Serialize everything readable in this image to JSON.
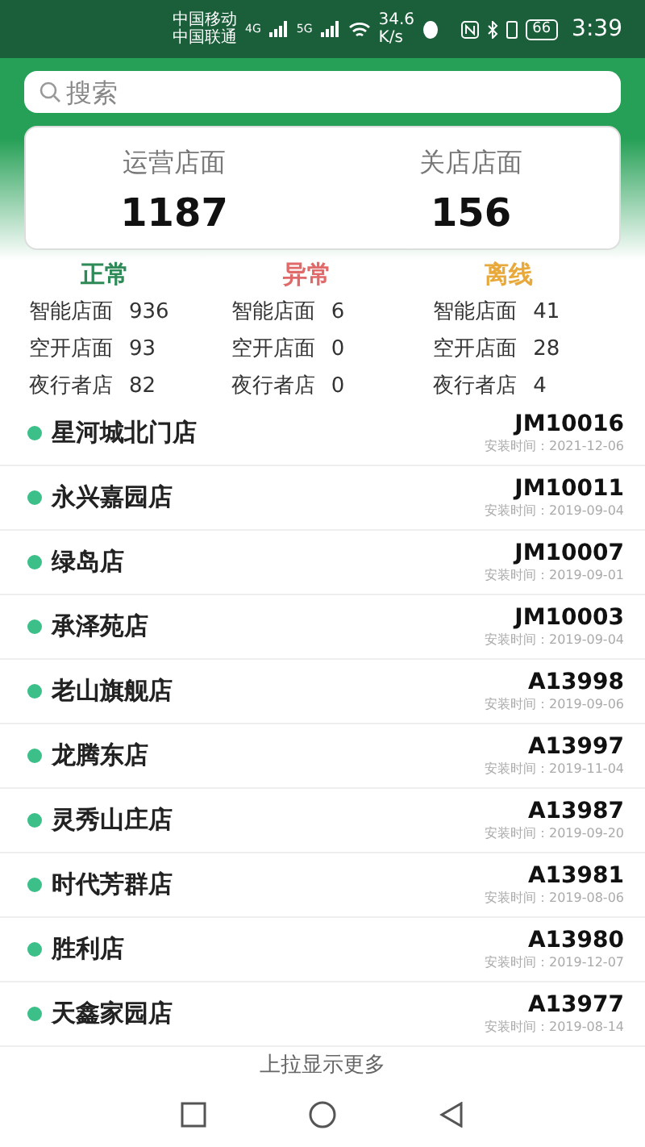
{
  "status_bar": {
    "carriers": [
      "中国移动",
      "中国联通"
    ],
    "network_labels": [
      "4G",
      "5G"
    ],
    "speed": "34.6",
    "speed_unit": "K/s",
    "battery": "66",
    "time": "3:39"
  },
  "search": {
    "placeholder": "搜索"
  },
  "summary": [
    {
      "label": "运营店面",
      "value": "1187"
    },
    {
      "label": "关店店面",
      "value": "156"
    }
  ],
  "categories": [
    {
      "title": "正常",
      "color": "#2e8b57",
      "rows": [
        {
          "label": "智能店面",
          "value": "936"
        },
        {
          "label": "空开店面",
          "value": "93"
        },
        {
          "label": "夜行者店",
          "value": "82"
        }
      ]
    },
    {
      "title": "异常",
      "color": "#e06a6a",
      "rows": [
        {
          "label": "智能店面",
          "value": "6"
        },
        {
          "label": "空开店面",
          "value": "0"
        },
        {
          "label": "夜行者店",
          "value": "0"
        }
      ]
    },
    {
      "title": "离线",
      "color": "#e8a93a",
      "rows": [
        {
          "label": "智能店面",
          "value": "41"
        },
        {
          "label": "空开店面",
          "value": "28"
        },
        {
          "label": "夜行者店",
          "value": "4"
        }
      ]
    }
  ],
  "stores": [
    {
      "name": "星河城北门店",
      "code": "JM10016",
      "install": "安装时间：2021-12-06"
    },
    {
      "name": "永兴嘉园店",
      "code": "JM10011",
      "install": "安装时间：2019-09-04"
    },
    {
      "name": "绿岛店",
      "code": "JM10007",
      "install": "安装时间：2019-09-01"
    },
    {
      "name": "承泽苑店",
      "code": "JM10003",
      "install": "安装时间：2019-09-04"
    },
    {
      "name": "老山旗舰店",
      "code": "A13998",
      "install": "安装时间：2019-09-06"
    },
    {
      "name": "龙腾东店",
      "code": "A13997",
      "install": "安装时间：2019-11-04"
    },
    {
      "name": "灵秀山庄店",
      "code": "A13987",
      "install": "安装时间：2019-09-20"
    },
    {
      "name": "时代芳群店",
      "code": "A13981",
      "install": "安装时间：2019-08-06"
    },
    {
      "name": "胜利店",
      "code": "A13980",
      "install": "安装时间：2019-12-07"
    },
    {
      "name": "天鑫家园店",
      "code": "A13977",
      "install": "安装时间：2019-08-14"
    }
  ],
  "load_more": "上拉显示更多"
}
